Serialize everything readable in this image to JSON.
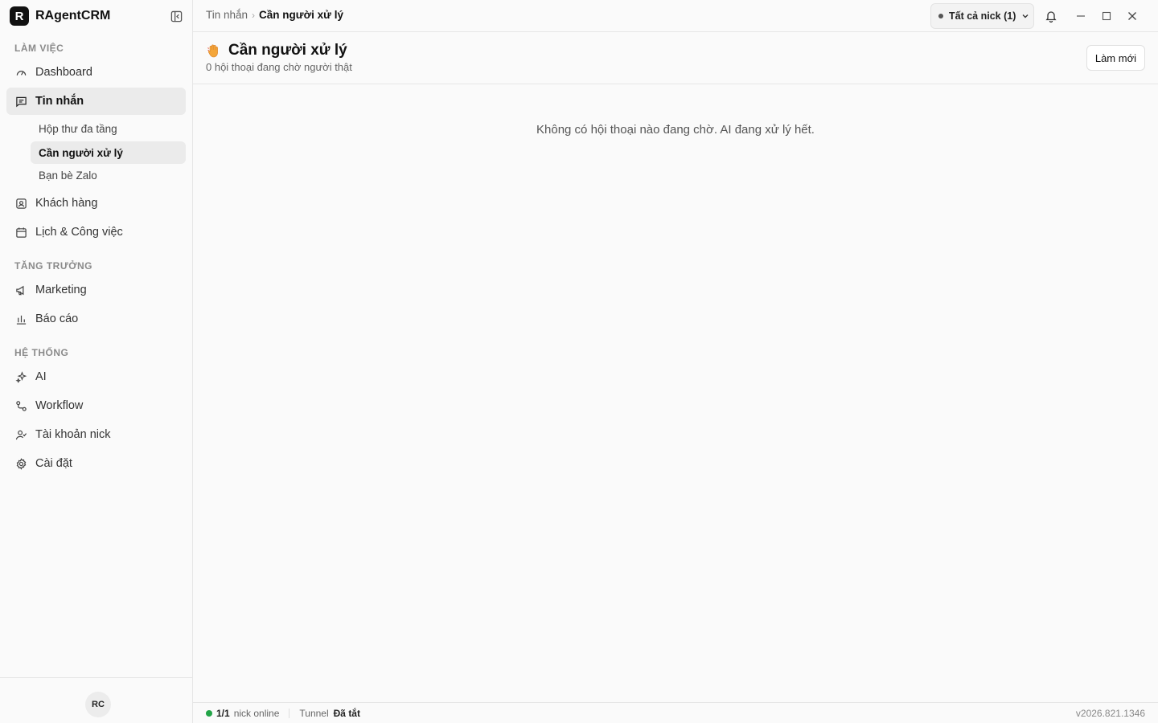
{
  "app": {
    "name": "RAgentCRM",
    "logo_letter": "R"
  },
  "sidebar": {
    "sections": [
      {
        "label": "LÀM VIỆC"
      },
      {
        "label": "TĂNG TRƯỞNG"
      },
      {
        "label": "HỆ THỐNG"
      }
    ],
    "items": {
      "dashboard": "Dashboard",
      "messages": "Tin nhắn",
      "customers": "Khách hàng",
      "calendar": "Lịch & Công việc",
      "marketing": "Marketing",
      "reports": "Báo cáo",
      "ai": "AI",
      "workflow": "Workflow",
      "accounts": "Tài khoản nick",
      "settings": "Cài đặt"
    },
    "sub_items": {
      "inbox": "Hộp thư đa tầng",
      "needs_human": "Cần người xử lý",
      "zalo_friends": "Bạn bè Zalo"
    },
    "user_initials": "RC"
  },
  "topbar": {
    "breadcrumb_parent": "Tin nhắn",
    "breadcrumb_current": "Cần người xử lý",
    "nick_filter": "Tất cả nick (1)"
  },
  "page": {
    "title": "Cần người xử lý",
    "subtitle": "0 hội thoại đang chờ người thật",
    "refresh_label": "Làm mới",
    "empty_message": "Không có hội thoại nào đang chờ. AI đang xử lý hết."
  },
  "status": {
    "nick_count": "1/1",
    "nick_label": "nick online",
    "tunnel_label": "Tunnel",
    "tunnel_state": "Đã tắt",
    "version": "v2026.821.1346"
  },
  "colors": {
    "accent": "#111111",
    "online": "#22a447",
    "emoji_orange": "#f0a030"
  }
}
